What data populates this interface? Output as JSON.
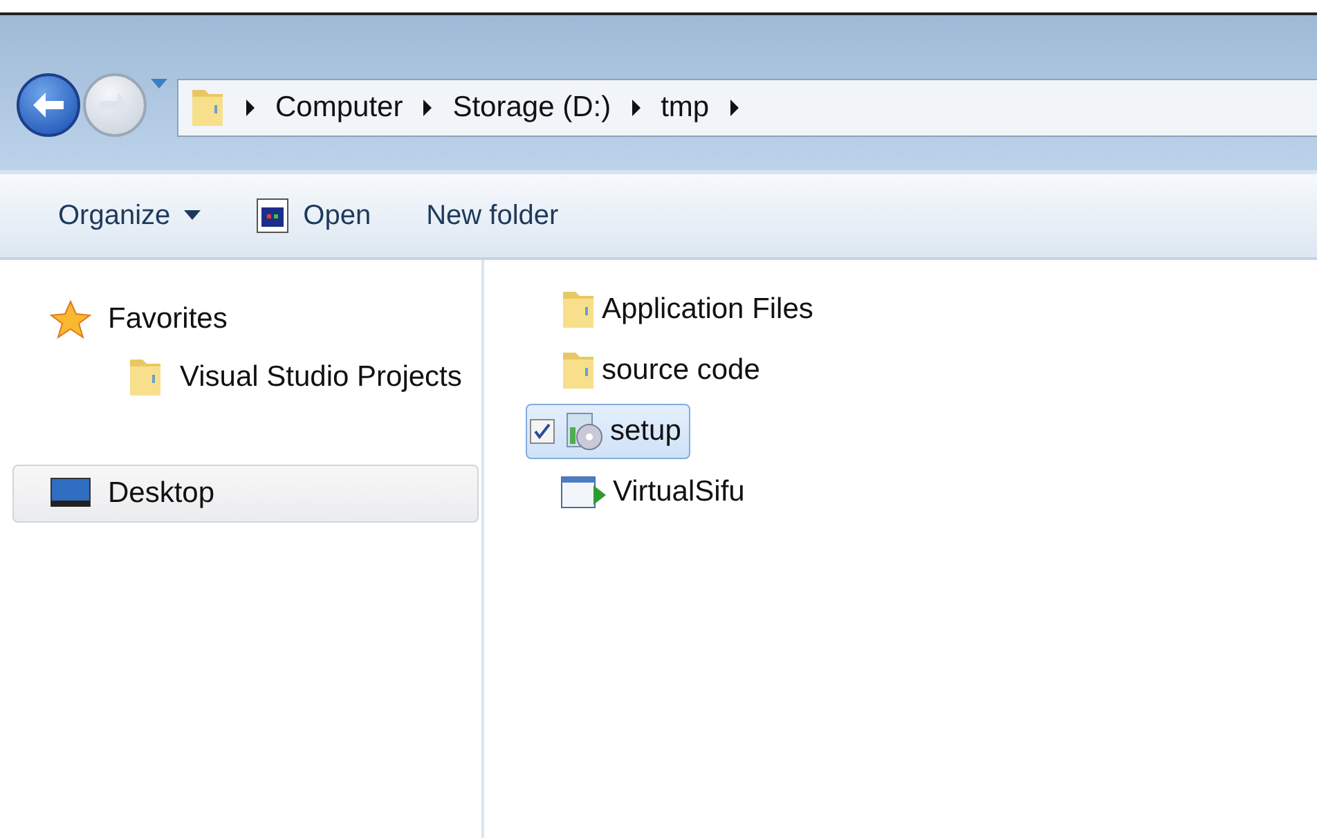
{
  "breadcrumb": [
    "Computer",
    "Storage (D:)",
    "tmp"
  ],
  "toolbar": [
    {
      "label": "Organize",
      "kind": "menu"
    },
    {
      "label": "Open",
      "kind": "open"
    },
    {
      "label": "New folder",
      "kind": "plain"
    }
  ],
  "sidebar": [
    {
      "label": "Favorites",
      "kind": "favorites",
      "selected": false,
      "children": [
        {
          "label": "Visual Studio Projects",
          "kind": "folder",
          "selected": false
        }
      ]
    },
    {
      "label": "Desktop",
      "kind": "desktop",
      "selected": true
    }
  ],
  "files": [
    {
      "name": "Application Files",
      "kind": "folder",
      "selected": false,
      "checked": false
    },
    {
      "name": "source code",
      "kind": "folder",
      "selected": false,
      "checked": false
    },
    {
      "name": "setup",
      "kind": "installer",
      "selected": true,
      "checked": true
    },
    {
      "name": "VirtualSifu",
      "kind": "app",
      "selected": false,
      "checked": false
    }
  ]
}
